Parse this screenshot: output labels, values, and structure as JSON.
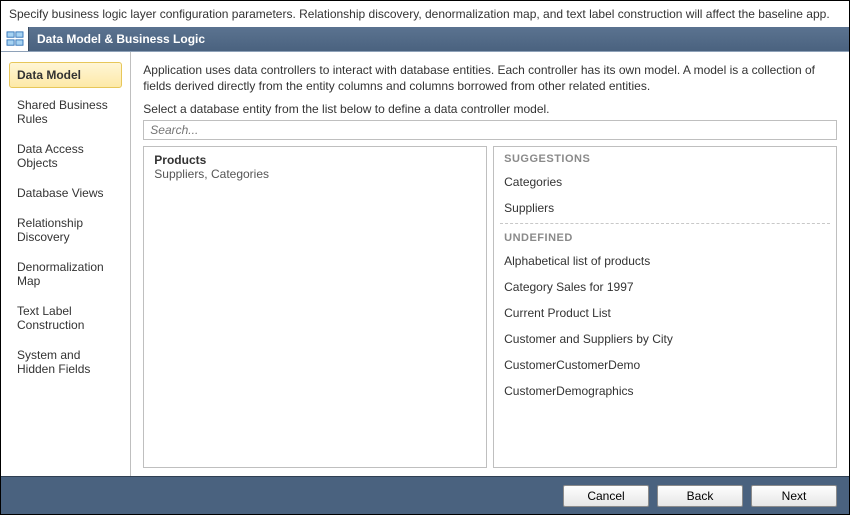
{
  "topDescription": "Specify business logic layer configuration parameters. Relationship discovery, denormalization map, and text label construction will affect the baseline app.",
  "titleBar": "Data Model & Business Logic",
  "sidebar": {
    "items": [
      {
        "label": "Data Model",
        "active": true
      },
      {
        "label": "Shared Business Rules",
        "active": false
      },
      {
        "label": "Data Access Objects",
        "active": false
      },
      {
        "label": "Database Views",
        "active": false
      },
      {
        "label": "Relationship Discovery",
        "active": false
      },
      {
        "label": "Denormalization Map",
        "active": false
      },
      {
        "label": "Text Label Construction",
        "active": false
      },
      {
        "label": "System and Hidden Fields",
        "active": false
      }
    ]
  },
  "main": {
    "intro": "Application uses data controllers to interact with database entities. Each controller has its own model. A model is a collection of fields derived directly from the entity columns and columns borrowed from other related entities.",
    "instruction": "Select a database entity from the list below to define a data controller model.",
    "searchPlaceholder": "Search...",
    "selectedEntity": {
      "name": "Products",
      "related": "Suppliers, Categories"
    },
    "suggestionsHeader": "SUGGESTIONS",
    "suggestions": [
      "Categories",
      "Suppliers"
    ],
    "undefinedHeader": "UNDEFINED",
    "undefinedList": [
      "Alphabetical list of products",
      "Category Sales for 1997",
      "Current Product List",
      "Customer and Suppliers by City",
      "CustomerCustomerDemo",
      "CustomerDemographics"
    ]
  },
  "footer": {
    "cancel": "Cancel",
    "back": "Back",
    "next": "Next"
  }
}
